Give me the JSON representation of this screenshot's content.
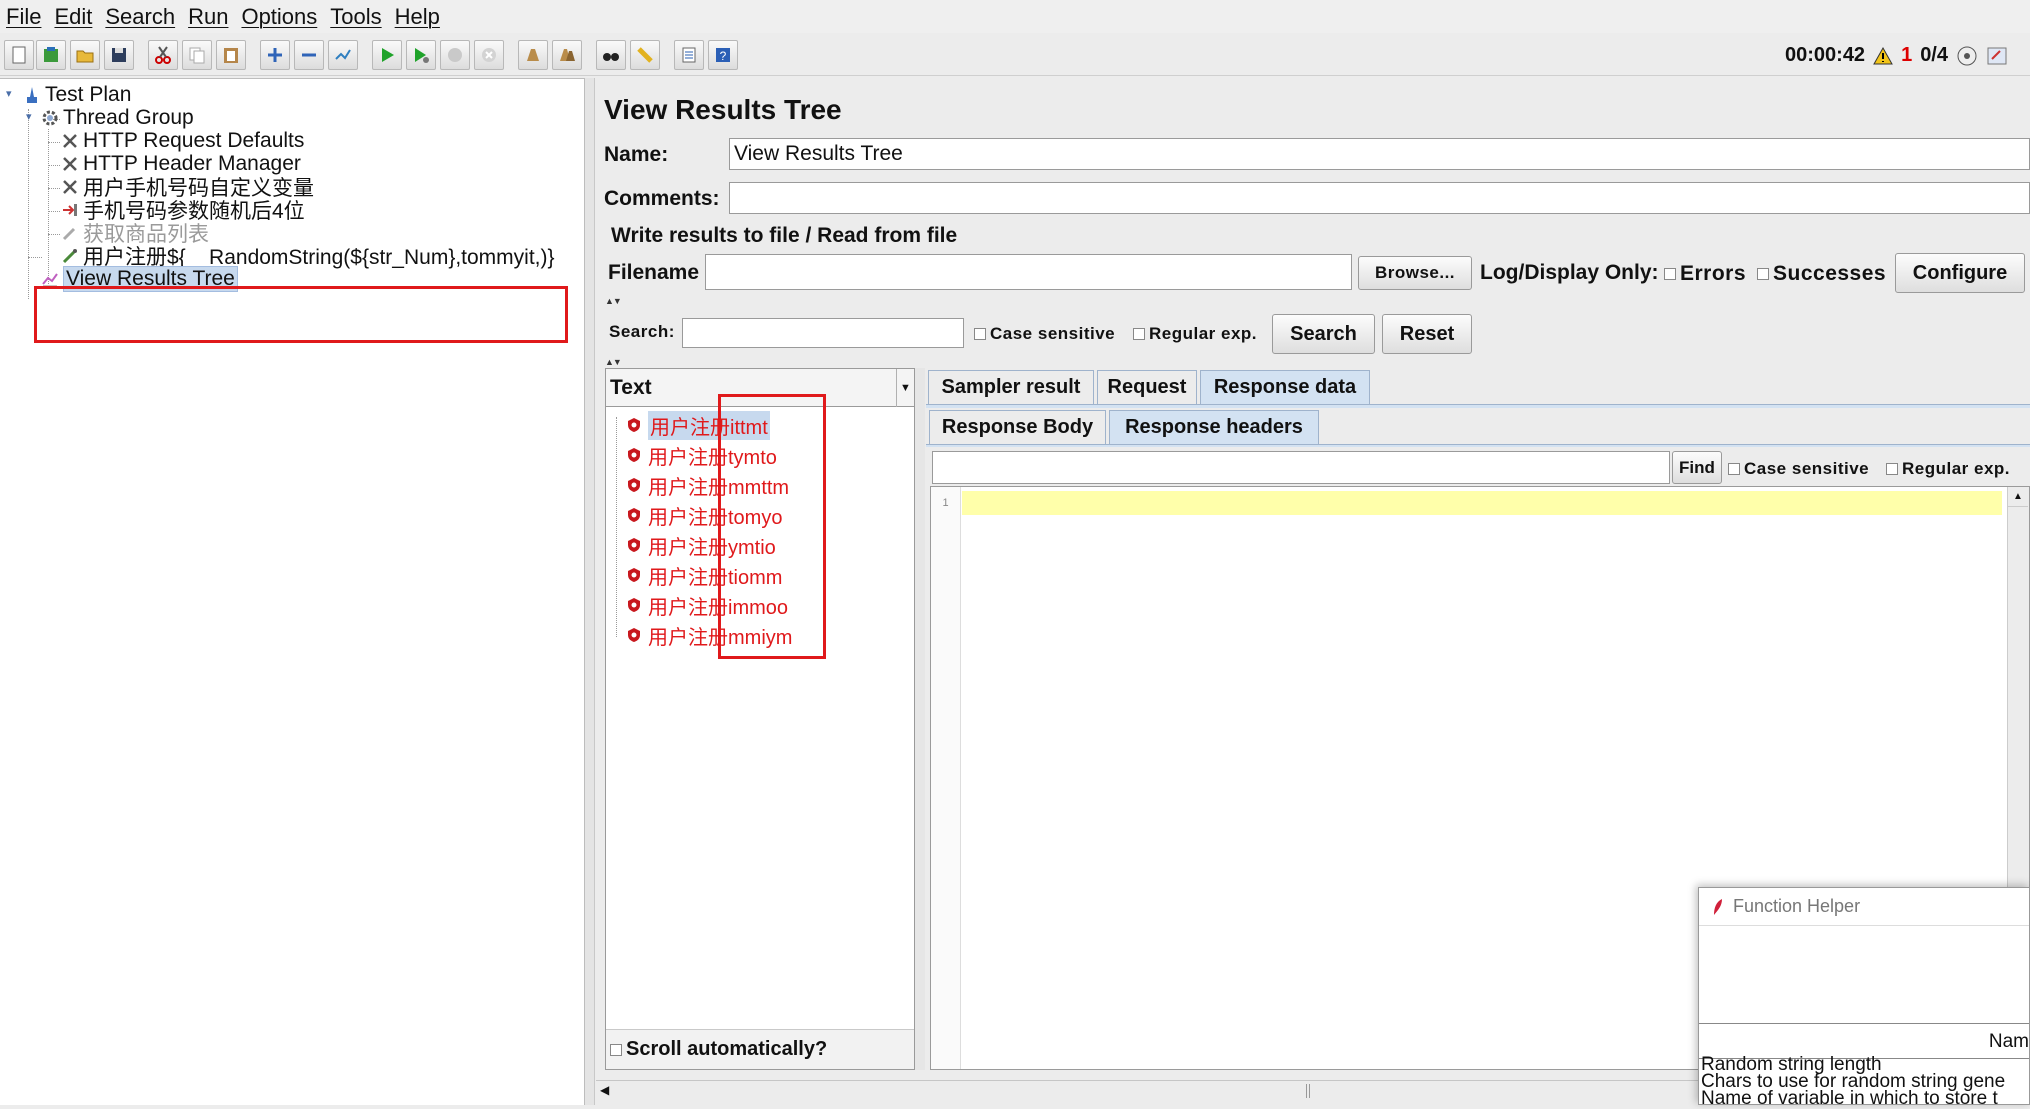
{
  "menu": [
    "File",
    "Edit",
    "Search",
    "Run",
    "Options",
    "Tools",
    "Help"
  ],
  "status": {
    "timer": "00:00:42",
    "warn_count": "1",
    "threads": "0/4"
  },
  "tree": {
    "test_plan": "Test Plan",
    "thread_group": "Thread Group",
    "http_defaults": "HTTP Request Defaults",
    "header_manager": "HTTP Header Manager",
    "phone_vars": "用户手机号码自定义变量",
    "phone_random": "手机号码参数随机后4位",
    "product_list": "获取商品列表",
    "register": "用户注册${__RandomString(${str_Num},tommyit,)}",
    "view_results": "View Results Tree"
  },
  "panel": {
    "title": "View Results Tree",
    "name_label": "Name:",
    "name_value": "View Results Tree",
    "comments_label": "Comments:",
    "write_section": "Write results to file / Read from file",
    "filename_label": "Filename",
    "browse": "Browse...",
    "log_display": "Log/Display Only:",
    "errors": "Errors",
    "successes": "Successes",
    "configure": "Configure",
    "search_label": "Search:",
    "case_sensitive": "Case sensitive",
    "regular_exp": "Regular exp.",
    "search_btn": "Search",
    "reset_btn": "Reset"
  },
  "results": {
    "renderer": "Text",
    "items": [
      "用户注册ittmt",
      "用户注册tymto",
      "用户注册mmttm",
      "用户注册tomyo",
      "用户注册ymtio",
      "用户注册tiomm",
      "用户注册immoo",
      "用户注册mmiym"
    ],
    "scroll_auto": "Scroll automatically?"
  },
  "tabs": {
    "sampler": "Sampler result",
    "request": "Request",
    "response": "Response data",
    "body": "Response Body",
    "headers": "Response headers"
  },
  "find": {
    "label": "Find",
    "case": "Case sensitive",
    "regex": "Regular exp."
  },
  "editor": {
    "line": "1"
  },
  "function_helper": {
    "title": "Function Helper",
    "name_col": "Nam",
    "rows": [
      "Random string length",
      "Chars to use for random string gene",
      "Name of variable in which to store t"
    ]
  }
}
